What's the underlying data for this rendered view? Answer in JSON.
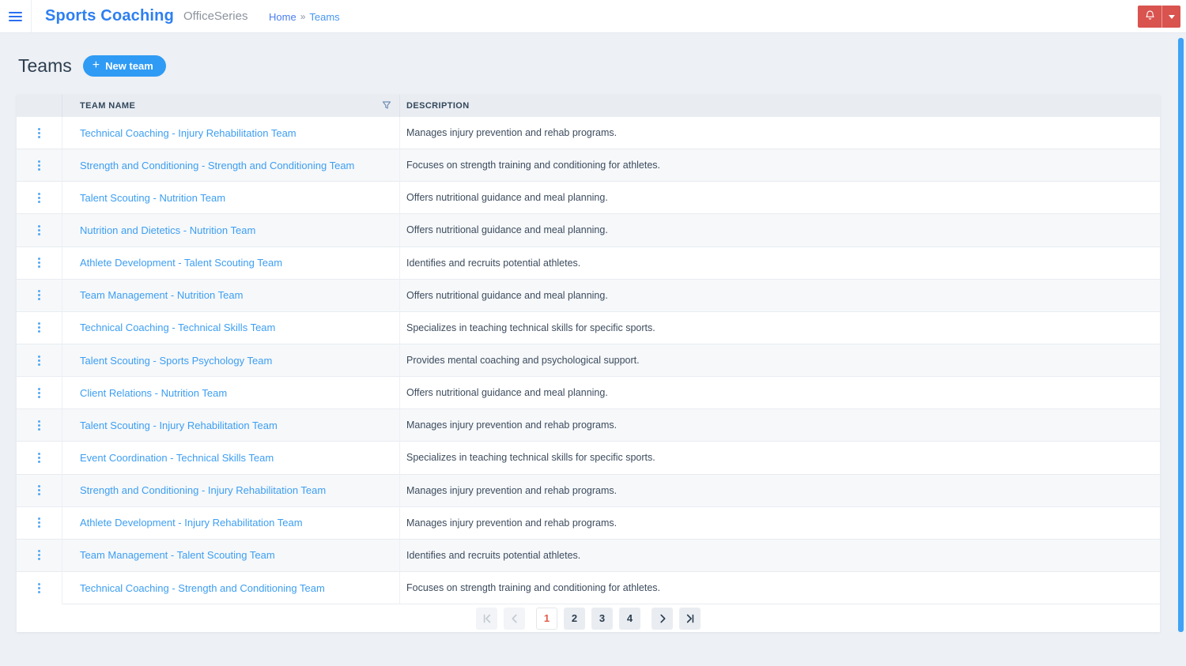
{
  "header": {
    "app_title": "Sports Coaching",
    "app_subtitle": "OfficeSeries",
    "breadcrumb": {
      "home": "Home",
      "separator": "»",
      "current": "Teams"
    },
    "icons": [
      "hamburger-icon",
      "bell-icon",
      "caret-down-icon"
    ]
  },
  "page": {
    "title": "Teams",
    "new_team_button": {
      "plus": "+",
      "label": "New team"
    }
  },
  "table": {
    "columns": {
      "team_name": "TEAM NAME",
      "description": "DESCRIPTION"
    },
    "filter_icon": "filter-funnel-icon",
    "row_menu_icon": "kebab-vertical-dots-icon",
    "rows": [
      {
        "name": "Technical Coaching - Injury Rehabilitation Team",
        "description": "Manages injury prevention and rehab programs."
      },
      {
        "name": "Strength and Conditioning - Strength and Conditioning Team",
        "description": "Focuses on strength training and conditioning for athletes."
      },
      {
        "name": "Talent Scouting - Nutrition Team",
        "description": "Offers nutritional guidance and meal planning."
      },
      {
        "name": "Nutrition and Dietetics - Nutrition Team",
        "description": "Offers nutritional guidance and meal planning."
      },
      {
        "name": "Athlete Development - Talent Scouting Team",
        "description": "Identifies and recruits potential athletes."
      },
      {
        "name": "Team Management - Nutrition Team",
        "description": "Offers nutritional guidance and meal planning."
      },
      {
        "name": "Technical Coaching - Technical Skills Team",
        "description": "Specializes in teaching technical skills for specific sports."
      },
      {
        "name": "Talent Scouting - Sports Psychology Team",
        "description": "Provides mental coaching and psychological support."
      },
      {
        "name": "Client Relations - Nutrition Team",
        "description": "Offers nutritional guidance and meal planning."
      },
      {
        "name": "Talent Scouting - Injury Rehabilitation Team",
        "description": "Manages injury prevention and rehab programs."
      },
      {
        "name": "Event Coordination - Technical Skills Team",
        "description": "Specializes in teaching technical skills for specific sports."
      },
      {
        "name": "Strength and Conditioning - Injury Rehabilitation Team",
        "description": "Manages injury prevention and rehab programs."
      },
      {
        "name": "Athlete Development - Injury Rehabilitation Team",
        "description": "Manages injury prevention and rehab programs."
      },
      {
        "name": "Team Management - Talent Scouting Team",
        "description": "Identifies and recruits potential athletes."
      },
      {
        "name": "Technical Coaching - Strength and Conditioning Team",
        "description": "Focuses on strength training and conditioning for athletes."
      }
    ]
  },
  "pagination": {
    "pages": [
      "1",
      "2",
      "3",
      "4"
    ],
    "current": "1",
    "icons": [
      "first-page-icon",
      "prev-page-icon",
      "next-page-icon",
      "last-page-icon"
    ]
  },
  "colors": {
    "accent_blue": "#2f9bf5",
    "link_blue": "#3d9ef2",
    "brand_blue": "#2d7ff2",
    "danger_red": "#d9534f",
    "current_page_red": "#e25c4a",
    "table_header_bg": "#e9edf2",
    "page_bg": "#edf0f4",
    "scrollbar_blue": "#3fa2f5"
  }
}
